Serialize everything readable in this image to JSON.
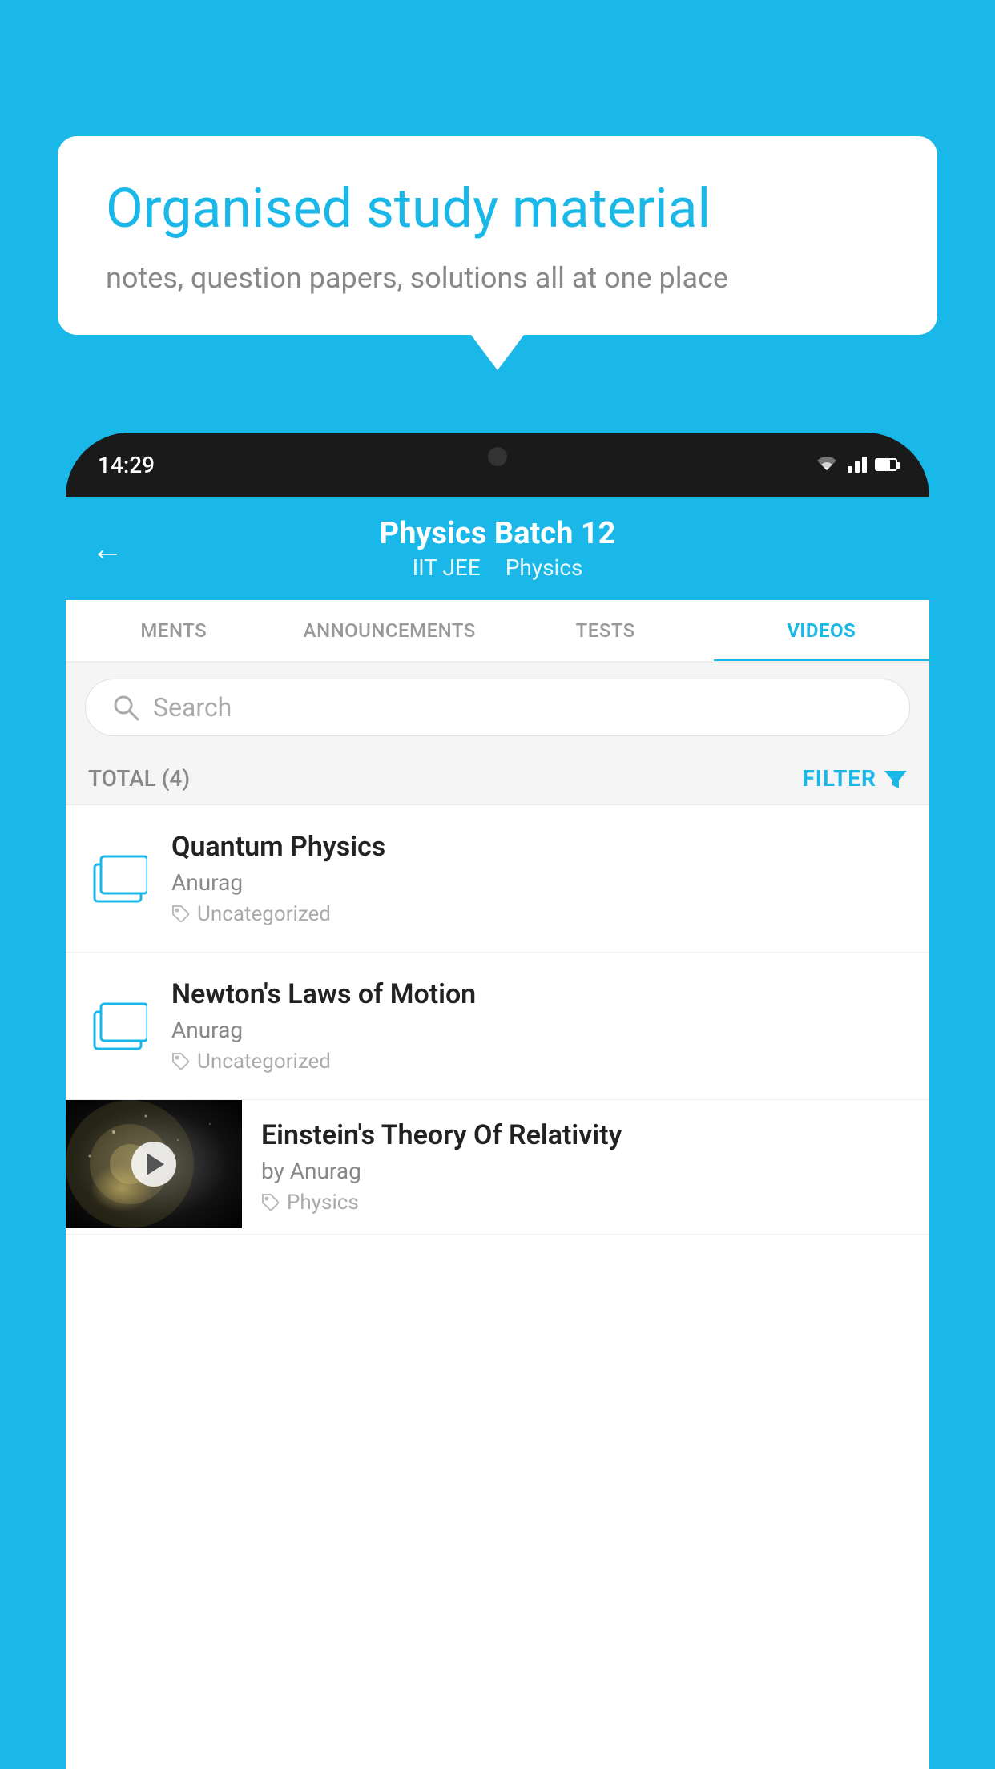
{
  "page": {
    "bg_color": "#1ab8e8"
  },
  "speech_bubble": {
    "title": "Organised study material",
    "subtitle": "notes, question papers, solutions all at one place"
  },
  "status_bar": {
    "time": "14:29"
  },
  "app_header": {
    "back_label": "←",
    "title": "Physics Batch 12",
    "tag1": "IIT JEE",
    "tag2": "Physics"
  },
  "tabs": [
    {
      "label": "MENTS",
      "active": false
    },
    {
      "label": "ANNOUNCEMENTS",
      "active": false
    },
    {
      "label": "TESTS",
      "active": false
    },
    {
      "label": "VIDEOS",
      "active": true
    }
  ],
  "search": {
    "placeholder": "Search"
  },
  "filter_row": {
    "total_label": "TOTAL (4)",
    "filter_label": "FILTER"
  },
  "list_items": [
    {
      "id": "quantum-physics",
      "title": "Quantum Physics",
      "author": "Anurag",
      "tag": "Uncategorized",
      "type": "folder"
    },
    {
      "id": "newtons-laws",
      "title": "Newton's Laws of Motion",
      "author": "Anurag",
      "tag": "Uncategorized",
      "type": "folder"
    }
  ],
  "video_item": {
    "title": "Einstein's Theory Of Relativity",
    "author": "by Anurag",
    "tag": "Physics"
  }
}
